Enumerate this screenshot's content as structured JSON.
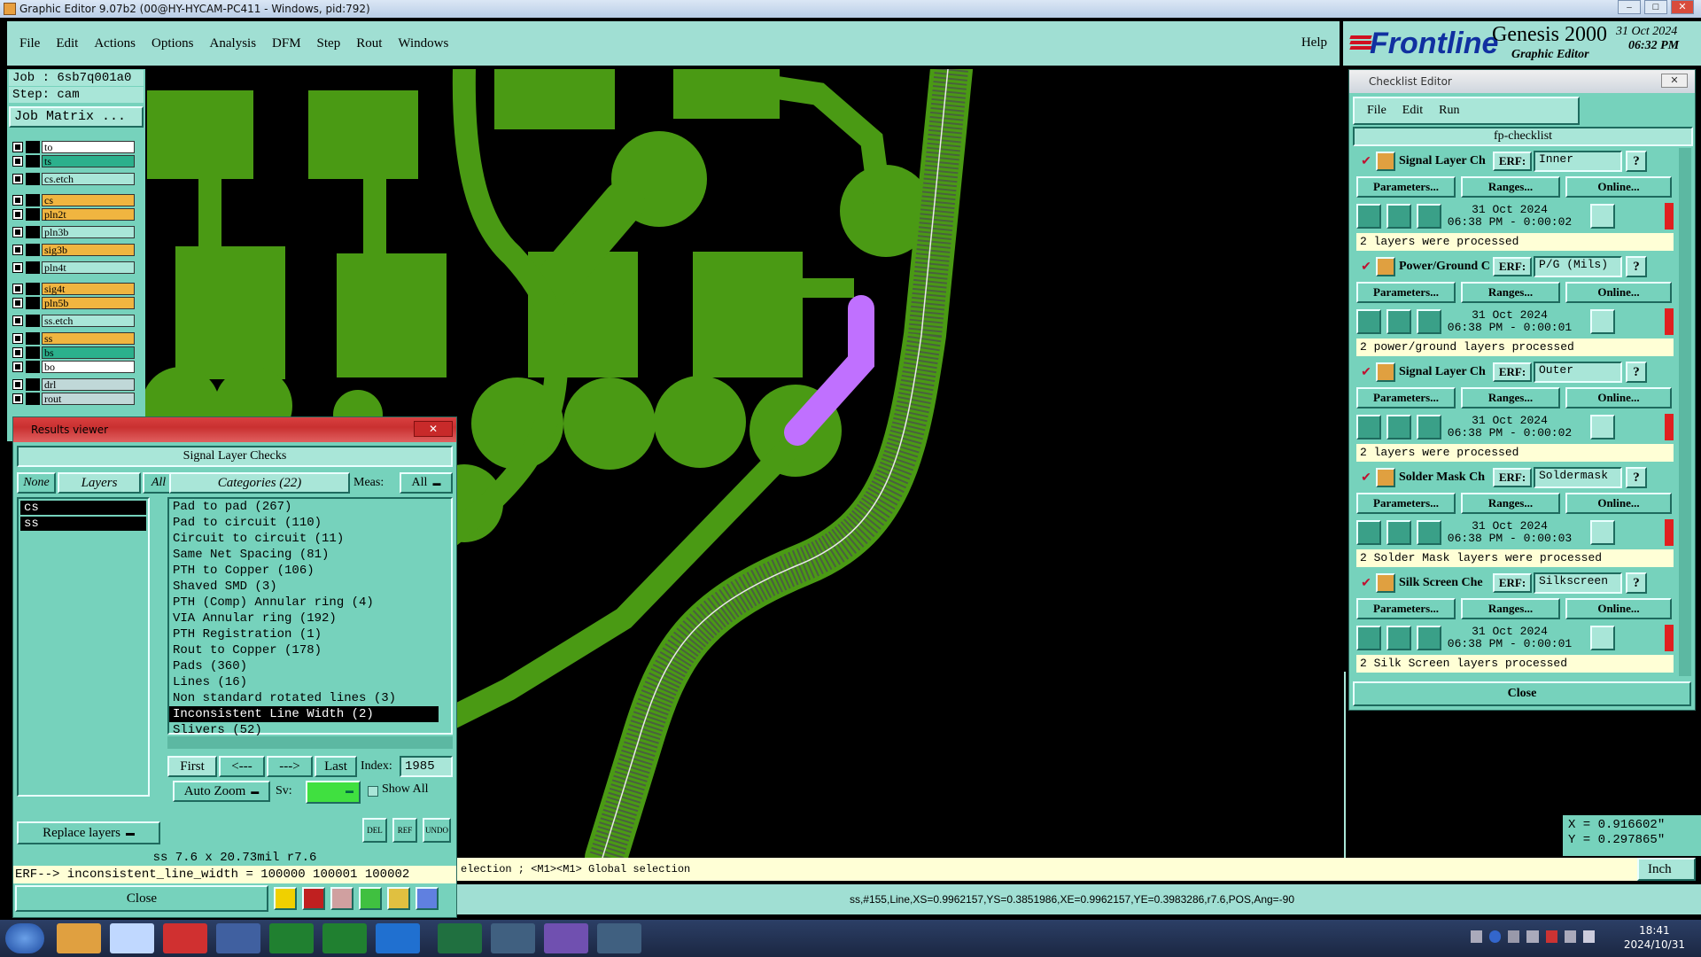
{
  "window": {
    "title": "Graphic Editor 9.07b2 (00@HY-HYCAM-PC411 - Windows, pid:792)"
  },
  "menubar": {
    "items": [
      "File",
      "Edit",
      "Actions",
      "Options",
      "Analysis",
      "DFM",
      "Step",
      "Rout",
      "Windows"
    ],
    "help": "Help"
  },
  "brand": {
    "logo": "Frontline",
    "product": "Genesis 2000",
    "subtitle": "Graphic Editor",
    "date": "31 Oct 2024",
    "time": "06:32 PM"
  },
  "job": {
    "job_label": "Job : 6sb7q001a0",
    "step_label": "Step: cam",
    "matrix_button": "Job Matrix ..."
  },
  "layers": [
    {
      "name": "to",
      "color": "#ffffff"
    },
    {
      "name": "ts",
      "color": "#2bb08c"
    },
    {
      "name": "cs.etch",
      "color": "#a9e6d8"
    },
    {
      "name": "cs",
      "color": "#f0b540"
    },
    {
      "name": "pln2t",
      "color": "#f0b540"
    },
    {
      "name": "pln3b",
      "color": "#a9e6d8"
    },
    {
      "name": "sig3b",
      "color": "#f0b540"
    },
    {
      "name": "pln4t",
      "color": "#a9e6d8"
    },
    {
      "name": "sig4t",
      "color": "#f0b540"
    },
    {
      "name": "pln5b",
      "color": "#f0b540"
    },
    {
      "name": "ss.etch",
      "color": "#a9e6d8"
    },
    {
      "name": "ss",
      "color": "#f0b540"
    },
    {
      "name": "bs",
      "color": "#2bb08c"
    },
    {
      "name": "bo",
      "color": "#ffffff"
    },
    {
      "name": "drl",
      "color": "#c0d8d8"
    },
    {
      "name": "rout",
      "color": "#c0d8d8"
    }
  ],
  "coords": {
    "x": "X = 0.916602\"",
    "y": "Y = 0.297865\""
  },
  "command_line": "election ; <M1><M1> Global selection",
  "units": "Inch",
  "status_line": "ss,#155,Line,XS=0.9962157,YS=0.3851986,XE=0.9962157,YE=0.3983286,r7.6,POS,Ang=-90",
  "clock": {
    "time": "18:41",
    "date": "2024/10/31"
  },
  "results": {
    "title": "Results viewer",
    "header": "Signal Layer Checks",
    "none_btn": "None",
    "layers_btn": "Layers",
    "all_btn": "All",
    "categories_label": "Categories (22)",
    "meas_label": "Meas:",
    "meas_value": "All",
    "layer_list": [
      "cs",
      "ss"
    ],
    "categories": [
      "Pad to pad (267)",
      "Pad to circuit (110)",
      "Circuit to circuit (11)",
      "Same Net Spacing (81)",
      "PTH to Copper (106)",
      "Shaved SMD (3)",
      "PTH (Comp) Annular ring (4)",
      "VIA Annular ring (192)",
      "PTH Registration (1)",
      "Rout to Copper (178)",
      "Pads (360)",
      "Lines (16)",
      "Non standard rotated lines (3)",
      "Inconsistent Line Width (2)",
      "Slivers (52)"
    ],
    "selected_category": 13,
    "first_btn": "First",
    "prev_btn": "<---",
    "next_btn": "--->",
    "last_btn": "Last",
    "index_label": "Index:",
    "index_value": "1985",
    "autozoom_btn": "Auto Zoom",
    "sv_label": "Sv:",
    "show_all": "Show All",
    "replace_btn": "Replace layers",
    "del_icon": "DEL",
    "ref_icon": "REF",
    "undo_icon": "UNDO",
    "measure_text": "ss 7.6 x 20.73mil  r7.6",
    "erf_text": "ERF--> inconsistent_line_width = 100000 100001 100002",
    "close_btn": "Close"
  },
  "checklist": {
    "title": "Checklist Editor",
    "menu": [
      "File",
      "Edit",
      "Run"
    ],
    "name": "fp-checklist",
    "params_btn": "Parameters...",
    "ranges_btn": "Ranges...",
    "online_btn": "Online...",
    "erf_label": "ERF:",
    "items": [
      {
        "name": "Signal Layer Ch",
        "erf": "Inner",
        "date": "31 Oct 2024",
        "time": "06:38 PM - 0:00:02",
        "status": "2 layers were processed"
      },
      {
        "name": "Power/Ground C",
        "erf": "P/G (Mils)",
        "date": "31 Oct 2024",
        "time": "06:38 PM - 0:00:01",
        "status": "2 power/ground layers processed"
      },
      {
        "name": "Signal Layer Ch",
        "erf": "Outer",
        "date": "31 Oct 2024",
        "time": "06:38 PM - 0:00:02",
        "status": "2 layers were processed"
      },
      {
        "name": "Solder Mask Ch",
        "erf": "Soldermask",
        "date": "31 Oct 2024",
        "time": "06:38 PM - 0:00:03",
        "status": "2 Solder Mask layers were processed"
      },
      {
        "name": "Silk Screen Che",
        "erf": "Silkscreen",
        "date": "31 Oct 2024",
        "time": "06:38 PM - 0:00:01",
        "status": "2 Silk Screen layers processed"
      }
    ],
    "close_btn": "Close"
  }
}
